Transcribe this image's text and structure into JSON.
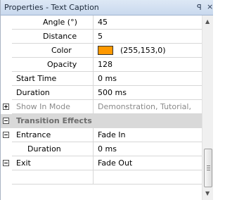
{
  "panel": {
    "title": "Properties - Text Caption",
    "pin_glyph": "ꟼ",
    "close_glyph": "×"
  },
  "rows": {
    "angle": {
      "label": "Angle (°)",
      "value": "45"
    },
    "distance": {
      "label": "Distance",
      "value": "5"
    },
    "color": {
      "label": "Color",
      "value": "(255,153,0)",
      "swatch": "#ff9900"
    },
    "opacity": {
      "label": "Opacity",
      "value": "128"
    },
    "start_time": {
      "label": "Start Time",
      "value": "0 ms"
    },
    "duration": {
      "label": "Duration",
      "value": "500 ms"
    },
    "show_in_mode": {
      "label": "Show In Mode",
      "value": "Demonstration, Tutorial,"
    },
    "transition_effects": {
      "label": "Transition Effects"
    },
    "entrance": {
      "label": "Entrance",
      "value": "Fade In"
    },
    "entrance_duration": {
      "label": "Duration",
      "value": "0 ms"
    },
    "exit": {
      "label": "Exit",
      "value": "Fade Out"
    }
  },
  "scrollbar": {
    "up": "▲",
    "down": "▼"
  },
  "colors": {
    "category_bg": "#d9d9d9",
    "grid_line": "#d7d7d7",
    "swatch": "#ff9900"
  }
}
